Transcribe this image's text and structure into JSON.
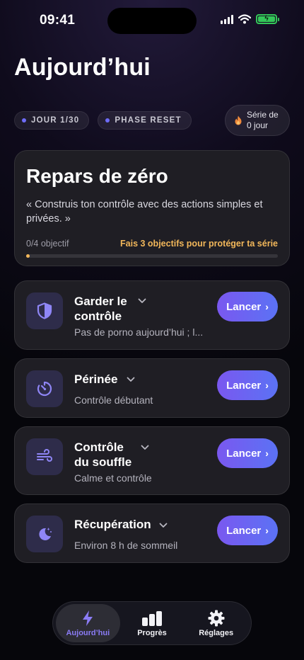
{
  "status_bar": {
    "time": "09:41"
  },
  "header": {
    "title": "Aujourd’hui"
  },
  "chips": [
    {
      "label": "JOUR 1/30"
    },
    {
      "label": "PHASE RESET"
    }
  ],
  "streak": {
    "line1": "Série de",
    "line2": "0 jour",
    "icon": "flame-icon"
  },
  "main_card": {
    "title": "Repars de zéro",
    "quote": "« Construis ton contrôle avec des actions simples et privées. »",
    "progress_text": "0/4 objectif",
    "hint": "Fais 3 objectifs pour protéger ta série",
    "progress_fraction": 0.0
  },
  "activities": [
    {
      "name": "Garder le contrôle",
      "sub": "Pas de porno aujourd’hui ; l...",
      "icon": "shield-icon",
      "button": "Lancer"
    },
    {
      "name": "Périnée",
      "sub": "Contrôle débutant",
      "icon": "timer-icon",
      "button": "Lancer"
    },
    {
      "name": "Contrôle du souffle",
      "sub": "Calme et contrôle",
      "icon": "wind-icon",
      "button": "Lancer"
    },
    {
      "name": "Récupération",
      "sub": "Environ 8 h de sommeil",
      "icon": "moon-icon",
      "button": "Lancer"
    }
  ],
  "tabs": [
    {
      "label": "Aujourd’hui",
      "icon": "bolt-icon",
      "active": true
    },
    {
      "label": "Progrès",
      "icon": "bars-icon",
      "active": false
    },
    {
      "label": "Réglages",
      "icon": "gear-icon",
      "active": false
    }
  ],
  "colors": {
    "accent": "#7a58f0",
    "warning": "#f2b75a",
    "battery": "#34c759"
  }
}
